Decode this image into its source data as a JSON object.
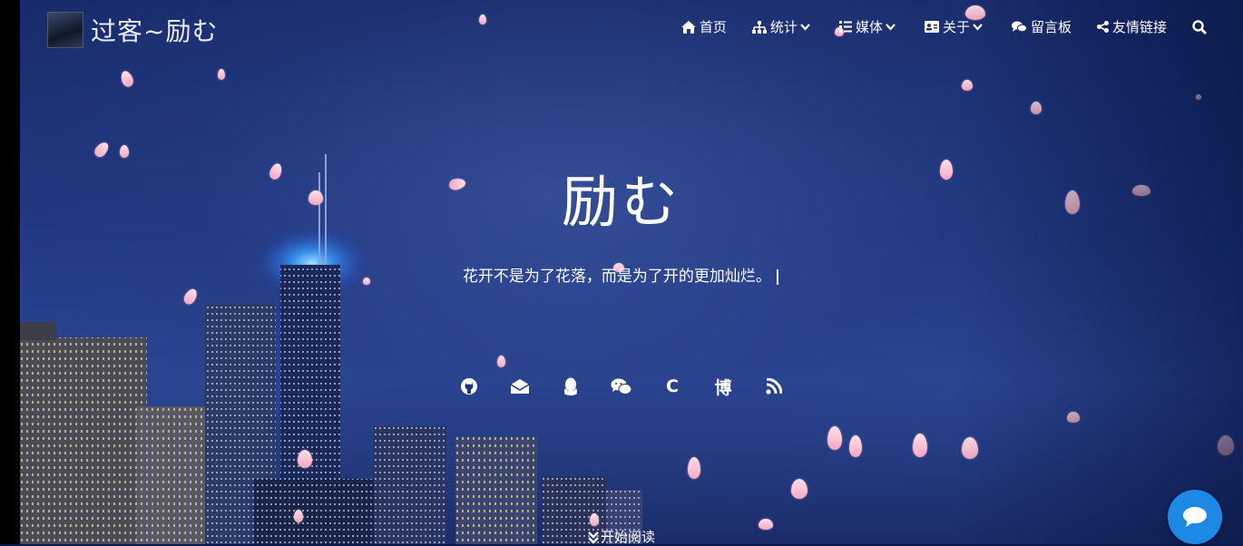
{
  "brand": {
    "title": "过客~励む"
  },
  "nav": {
    "items": [
      {
        "label": "首页",
        "icon": "home-icon",
        "has_dropdown": false
      },
      {
        "label": "统计",
        "icon": "sitemap-icon",
        "has_dropdown": true
      },
      {
        "label": "媒体",
        "icon": "list-icon",
        "has_dropdown": true
      },
      {
        "label": "关于",
        "icon": "id-card-icon",
        "has_dropdown": true
      },
      {
        "label": "留言板",
        "icon": "comments-icon",
        "has_dropdown": false
      },
      {
        "label": "友情链接",
        "icon": "share-icon",
        "has_dropdown": false
      }
    ],
    "search_icon": "search-icon"
  },
  "hero": {
    "title": "励む",
    "subtitle": "花开不是为了花落，而是为了开的更加灿烂。",
    "cursor": "|"
  },
  "social": [
    {
      "icon": "github-icon",
      "text": ""
    },
    {
      "icon": "email-icon",
      "text": ""
    },
    {
      "icon": "qq-icon",
      "text": ""
    },
    {
      "icon": "wechat-icon",
      "text": ""
    },
    {
      "icon": "csdn-icon",
      "text": "C"
    },
    {
      "icon": "blog-icon",
      "text": "博"
    },
    {
      "icon": "rss-icon",
      "text": ""
    }
  ],
  "start_reading": {
    "label": "开始阅读",
    "icon": "chevron-double-down-icon"
  },
  "chat": {
    "icon": "chat-bubble-icon",
    "color": "#1e88e5"
  },
  "colors": {
    "sky_top": "#172a6a",
    "sky_mid": "#2c4796",
    "petal": "#f6a8c0",
    "chat_button": "#1e88e5"
  }
}
